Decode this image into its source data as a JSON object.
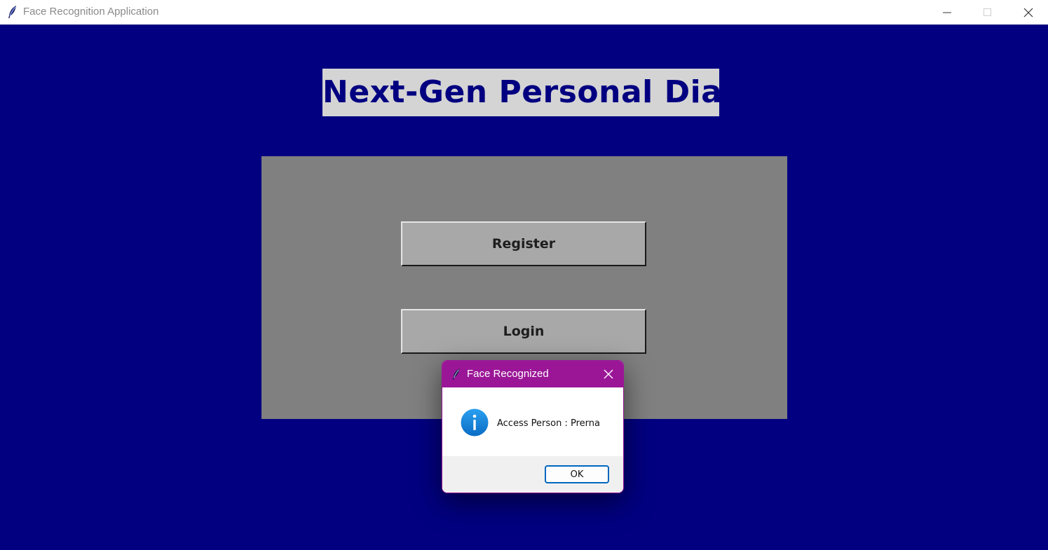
{
  "window": {
    "title": "Face Recognition Application",
    "icon": "feather-icon"
  },
  "main": {
    "heading": "Next-Gen Personal Diary",
    "register_label": "Register",
    "login_label": "Login"
  },
  "dialog": {
    "title": "Face Recognized",
    "icon": "info-icon",
    "message": "Access Person : Prerna",
    "ok_label": "OK"
  },
  "colors": {
    "background": "#020080",
    "panel": "#808080",
    "button": "#a8a8a8",
    "heading_bg": "#d4d4d4",
    "dialog_accent": "#9b1697"
  }
}
